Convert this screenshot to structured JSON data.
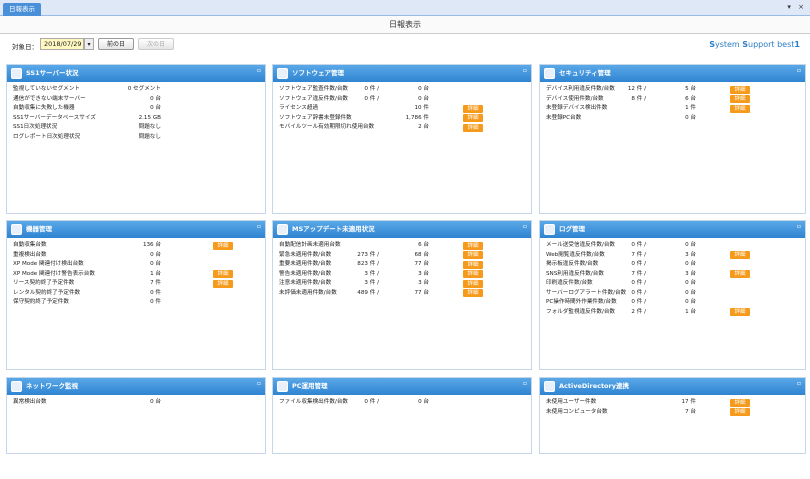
{
  "tab": {
    "label": "日報表示"
  },
  "window_controls": {
    "pin": "▾",
    "close": "×"
  },
  "title": "日報表示",
  "toolbar": {
    "date_label": "対象日：",
    "date_value": "2018/07/29",
    "date_drop": "▾",
    "prev_label": "前の日",
    "next_label": "次の日",
    "brand_s1": "S",
    "brand_r1": "ystem ",
    "brand_s2": "S",
    "brand_r2": "upport best",
    "brand_num": "1"
  },
  "panels": [
    {
      "title": "SS1サーバー状況",
      "rows": [
        {
          "label": "監視していないセグメント",
          "v1": "0 セグメント"
        },
        {
          "label": "通信ができない端末サーバー",
          "v1": "0 台"
        },
        {
          "label": "自動収集に失敗した機器",
          "v1": "0 台"
        },
        {
          "label": "SS1サーバーデータベースサイズ",
          "v1": "2.15 GB"
        },
        {
          "label": "SS1日次処理状況",
          "v1": "問題なし"
        },
        {
          "label": "ログレポート日次処理状況",
          "v1": "問題なし"
        }
      ]
    },
    {
      "title": "ソフトウェア管理",
      "rows": [
        {
          "label": "ソフトウェア監査件数/台数",
          "v1": "0 件 /",
          "v2": "0 台"
        },
        {
          "label": "ソフトウェア違反件数/台数",
          "v1": "0 件 /",
          "v2": "0 台"
        },
        {
          "label": "ライセンス超過",
          "v2": "10 件",
          "btn": "詳細"
        },
        {
          "label": "ソフトウェア辞書未登録件数",
          "v2": "1,786 件",
          "btn": "詳細"
        },
        {
          "label": "モバイルツール有効期限切れ使用台数",
          "v2": "2 台",
          "btn": "詳細"
        }
      ]
    },
    {
      "title": "セキュリティ管理",
      "rows": [
        {
          "label": "デバイス利用違反件数/台数",
          "v1": "12 件 /",
          "v2": "5 台",
          "btn": "詳細"
        },
        {
          "label": "デバイス使用件数/台数",
          "v1": "8 件 /",
          "v2": "6 台",
          "btn": "詳細"
        },
        {
          "label": "未登録デバイス検出件数",
          "v2": "1 件",
          "btn": "詳細"
        },
        {
          "label": "未登録PC台数",
          "v2": "0 台"
        }
      ]
    },
    {
      "title": "機器管理",
      "rows": [
        {
          "label": "自動収集台数",
          "v1": "136 台",
          "btn": "詳細"
        },
        {
          "label": "重複検出台数",
          "v1": "0 台"
        },
        {
          "label": "XP Mode 関連付け検出台数",
          "v1": "0 台"
        },
        {
          "label": "XP Mode 関連付け警告表示台数",
          "v1": "1 台",
          "btn": "詳細"
        },
        {
          "label": "リース契約終了予定件数",
          "v1": "7 件",
          "btn": "詳細"
        },
        {
          "label": "レンタル契約終了予定件数",
          "v1": "0 件"
        },
        {
          "label": "保守契約終了予定件数",
          "v1": "0 件"
        }
      ]
    },
    {
      "title": "MSアップデート未適用状況",
      "rows": [
        {
          "label": "自動配信計画未適用台数",
          "v2": "6 台",
          "btn": "詳細"
        },
        {
          "label": "緊急未適用件数/台数",
          "v1": "273 件 /",
          "v2": "68 台",
          "btn": "詳細"
        },
        {
          "label": "重要未適用件数/台数",
          "v1": "823 件 /",
          "v2": "77 台",
          "btn": "詳細"
        },
        {
          "label": "警告未適用件数/台数",
          "v1": "3 件 /",
          "v2": "3 台",
          "btn": "詳細"
        },
        {
          "label": "注意未適用件数/台数",
          "v1": "3 件 /",
          "v2": "3 台",
          "btn": "詳細"
        },
        {
          "label": "未評価未適用件数/台数",
          "v1": "489 件 /",
          "v2": "77 台",
          "btn": "詳細"
        }
      ]
    },
    {
      "title": "ログ管理",
      "rows": [
        {
          "label": "メール送受信違反件数/台数",
          "v1": "0 件 /",
          "v2": "0 台"
        },
        {
          "label": "Web閲覧違反件数/台数",
          "v1": "7 件 /",
          "v2": "3 台",
          "btn": "詳細"
        },
        {
          "label": "掲示板違反件数/台数",
          "v1": "0 件 /",
          "v2": "0 台"
        },
        {
          "label": "SNS利用違反件数/台数",
          "v1": "7 件 /",
          "v2": "3 台",
          "btn": "詳細"
        },
        {
          "label": "印刷違反件数/台数",
          "v1": "0 件 /",
          "v2": "0 台"
        },
        {
          "label": "サーバーログアラート件数/台数",
          "v1": "0 件 /",
          "v2": "0 台"
        },
        {
          "label": "PC操作時間外作業件数/台数",
          "v1": "0 件 /",
          "v2": "0 台"
        },
        {
          "label": "フォルダ監視違反件数/台数",
          "v1": "2 件 /",
          "v2": "1 台",
          "btn": "詳細"
        }
      ]
    },
    {
      "title": "ネットワーク監視",
      "rows": [
        {
          "label": "異常検出台数",
          "v1": "0 台"
        }
      ]
    },
    {
      "title": "PC運用管理",
      "rows": [
        {
          "label": "ファイル収集検出件数/台数",
          "v1": "0 件 /",
          "v2": "0 台"
        }
      ]
    },
    {
      "title": "ActiveDirectory連携",
      "rows": [
        {
          "label": "未使用ユーザー件数",
          "v2": "17 件",
          "btn": "詳細"
        },
        {
          "label": "未使用コンピュータ台数",
          "v2": "7 台",
          "btn": "詳細"
        }
      ]
    }
  ],
  "colors": {
    "header": "#2f84d1",
    "detail_button": "#f59a1b",
    "brand": "#2c7cc4"
  }
}
